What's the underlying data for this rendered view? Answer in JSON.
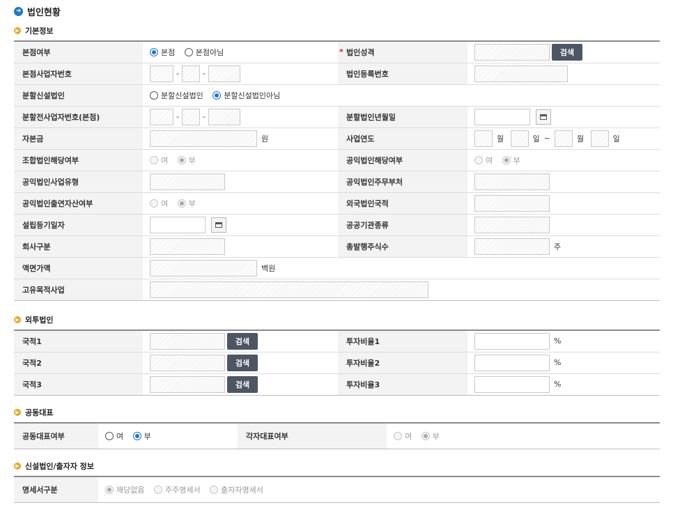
{
  "page_title": "법인현황",
  "basic": {
    "title": "기본정보",
    "hq_label": "본점여부",
    "hq_opt1": "본점",
    "hq_opt2": "본점아님",
    "corp_type_label": "법인성격",
    "search": "검색",
    "hq_bizno_label": "본점사업자번호",
    "corp_regno_label": "법인등록번호",
    "split_label": "분할신설법인",
    "split_opt1": "분할신설법인",
    "split_opt2": "분할신설법인아님",
    "pre_split_label": "분할전사업자번호(본점)",
    "split_date_label": "분할법인년월일",
    "capital_label": "자본금",
    "capital_unit": "원",
    "fiscal_label": "사업연도",
    "month": "월",
    "day": "일",
    "tilde": "~",
    "union_label": "조합법인해당여부",
    "public_label": "공익법인해당여부",
    "yes": "여",
    "no": "부",
    "public_biz_label": "공익법인사업유형",
    "public_ministry_label": "공익법인주무부처",
    "public_invest_label": "공익법인출연자산여부",
    "foreign_country_label": "외국법인국적",
    "reg_date_label": "설립등기일자",
    "public_inst_label": "공공기관종류",
    "company_div_label": "회사구분",
    "total_shares_label": "총발행주식수",
    "shares_unit": "주",
    "par_value_label": "액면가액",
    "par_unit": "백원",
    "purpose_label": "고유목적사업"
  },
  "foreign": {
    "title": "외투법인",
    "rows": [
      {
        "country": "국적1",
        "ratio": "투자비율1"
      },
      {
        "country": "국적2",
        "ratio": "투자비율2"
      },
      {
        "country": "국적3",
        "ratio": "투자비율3"
      }
    ],
    "search": "검색",
    "pct": "%"
  },
  "joint": {
    "title": "공동대표",
    "joint_label": "공동대표여부",
    "each_label": "각자대표여부",
    "yes": "여",
    "no": "부"
  },
  "newcorp": {
    "title": "신설법인/출자자 정보",
    "spec_label": "명세서구분",
    "opt1": "해당없음",
    "opt2": "주주명세서",
    "opt3": "출자자명세서"
  }
}
